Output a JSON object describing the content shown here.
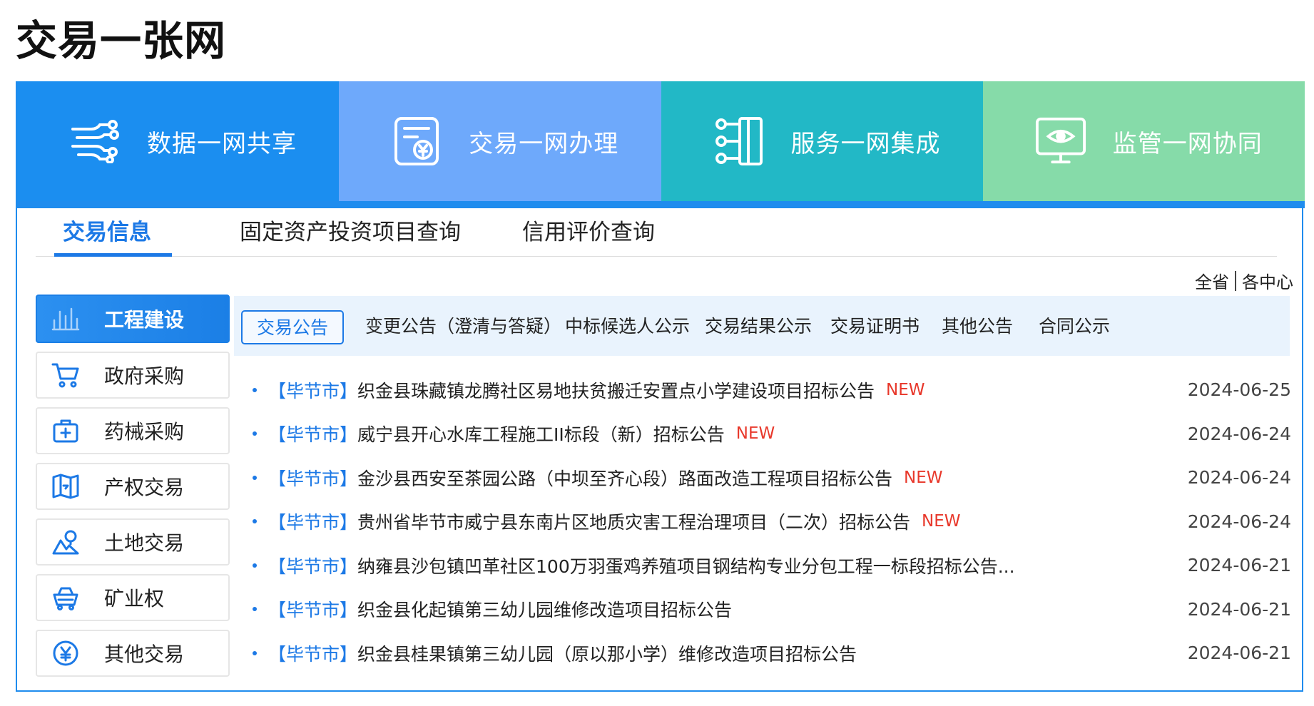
{
  "page": {
    "title": "交易一张网"
  },
  "banner": [
    {
      "label": "数据一网共享",
      "icon": "data-share-icon",
      "color": "#1b8ef0"
    },
    {
      "label": "交易一网办理",
      "icon": "transaction-document-icon",
      "color": "#6ea9fb"
    },
    {
      "label": "服务一网集成",
      "icon": "service-integration-icon",
      "color": "#22b8c6"
    },
    {
      "label": "监管一网协同",
      "icon": "monitor-eye-icon",
      "color": "#86dba9"
    }
  ],
  "tabs": [
    {
      "label": "交易信息",
      "active": true
    },
    {
      "label": "固定资产投资项目查询",
      "active": false
    },
    {
      "label": "信用评价查询",
      "active": false
    }
  ],
  "scope": {
    "all": "全省",
    "centers": "各中心"
  },
  "sidebar": [
    {
      "label": "工程建设",
      "icon": "construction-chart-icon",
      "active": true
    },
    {
      "label": "政府采购",
      "icon": "shopping-cart-icon",
      "active": false
    },
    {
      "label": "药械采购",
      "icon": "medical-kit-icon",
      "active": false
    },
    {
      "label": "产权交易",
      "icon": "property-map-icon",
      "active": false
    },
    {
      "label": "土地交易",
      "icon": "land-location-icon",
      "active": false
    },
    {
      "label": "矿业权",
      "icon": "mining-cart-icon",
      "active": false
    },
    {
      "label": "其他交易",
      "icon": "yen-coin-icon",
      "active": false
    }
  ],
  "subtabs": [
    {
      "label": "交易公告",
      "active": true
    },
    {
      "label": "变更公告（澄清与答疑）",
      "active": false
    },
    {
      "label": "中标候选人公示",
      "active": false
    },
    {
      "label": "交易结果公示",
      "active": false
    },
    {
      "label": "交易证明书",
      "active": false
    },
    {
      "label": "其他公告",
      "active": false
    },
    {
      "label": "合同公示",
      "active": false
    }
  ],
  "announcements": [
    {
      "region": "【毕节市】",
      "title": "织金县珠藏镇龙腾社区易地扶贫搬迁安置点小学建设项目招标公告",
      "badge": "NEW",
      "date": "2024-06-25"
    },
    {
      "region": "【毕节市】",
      "title": "威宁县开心水库工程施工II标段（新）招标公告",
      "badge": "NEW",
      "date": "2024-06-24"
    },
    {
      "region": "【毕节市】",
      "title": "金沙县西安至茶园公路（中坝至齐心段）路面改造工程项目招标公告",
      "badge": "NEW",
      "date": "2024-06-24"
    },
    {
      "region": "【毕节市】",
      "title": "贵州省毕节市威宁县东南片区地质灾害工程治理项目（二次）招标公告",
      "badge": "NEW",
      "date": "2024-06-24"
    },
    {
      "region": "【毕节市】",
      "title": "纳雍县沙包镇凹革社区100万羽蛋鸡养殖项目钢结构专业分包工程一标段招标公告...",
      "badge": "",
      "date": "2024-06-21"
    },
    {
      "region": "【毕节市】",
      "title": "织金县化起镇第三幼儿园维修改造项目招标公告",
      "badge": "",
      "date": "2024-06-21"
    },
    {
      "region": "【毕节市】",
      "title": "织金县桂果镇第三幼儿园（原以那小学）维修改造项目招标公告",
      "badge": "",
      "date": "2024-06-21"
    }
  ]
}
